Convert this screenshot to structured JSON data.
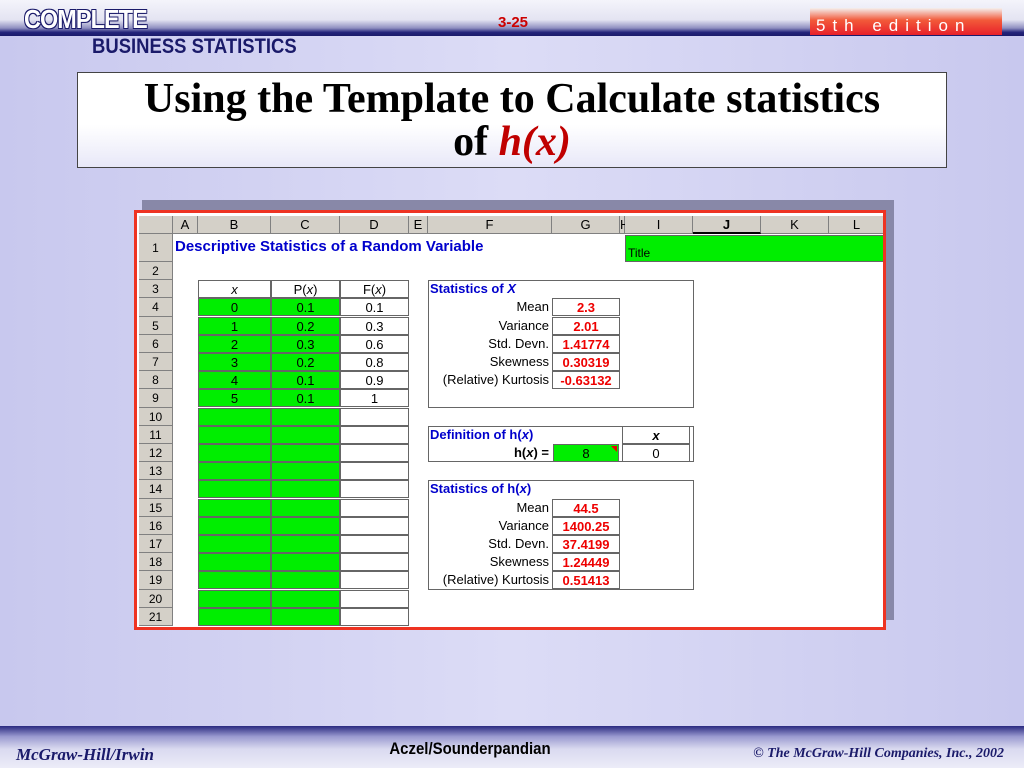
{
  "header": {
    "brand_line1": "COMPLETE",
    "brand_line2": "BUSINESS STATISTICS",
    "slide_number": "3-25",
    "edition": "5th edition"
  },
  "title": {
    "line1": "Using the Template to Calculate statistics",
    "line2_prefix": "of ",
    "line2_func": "h(x)"
  },
  "sheet": {
    "columns": [
      "",
      "A",
      "B",
      "C",
      "D",
      "E",
      "F",
      "G",
      "H",
      "I",
      "J",
      "K",
      "L"
    ],
    "selected_column": "J",
    "rows": [
      "1",
      "2",
      "3",
      "4",
      "5",
      "6",
      "7",
      "8",
      "9",
      "10",
      "11",
      "12",
      "13",
      "14",
      "15",
      "16",
      "17",
      "18",
      "19",
      "20",
      "21"
    ],
    "heading": "Descriptive Statistics of a Random Variable",
    "title_cell": "Title",
    "table": {
      "headers": [
        "x",
        "P(x)",
        "F(x)"
      ],
      "x": [
        "0",
        "1",
        "2",
        "3",
        "4",
        "5"
      ],
      "px": [
        "0.1",
        "0.2",
        "0.3",
        "0.2",
        "0.1",
        "0.1"
      ],
      "fx": [
        "0.1",
        "0.3",
        "0.6",
        "0.8",
        "0.9",
        "1"
      ]
    },
    "stats_x": {
      "title": "Statistics of X",
      "labels": [
        "Mean",
        "Variance",
        "Std. Devn.",
        "Skewness",
        "(Relative) Kurtosis"
      ],
      "values": [
        "2.3",
        "2.01",
        "1.41774",
        "0.30319",
        "-0.63132"
      ]
    },
    "definition": {
      "title": "Definition of h(x)",
      "x_header": "x",
      "label": "h(x) =",
      "value": "8",
      "x_value": "0"
    },
    "stats_hx": {
      "title": "Statistics of h(x)",
      "labels": [
        "Mean",
        "Variance",
        "Std. Devn.",
        "Skewness",
        "(Relative) Kurtosis"
      ],
      "values": [
        "44.5",
        "1400.25",
        "37.4199",
        "1.24449",
        "0.51413"
      ]
    }
  },
  "footer": {
    "publisher": "McGraw-Hill/Irwin",
    "authors": "Aczel/Sounderpandian",
    "copyright": "© The McGraw-Hill Companies, Inc., 2002"
  },
  "colors": {
    "accent_red": "#ee3322",
    "cell_green": "#00ee00",
    "header_navy": "#1a1a6a"
  }
}
